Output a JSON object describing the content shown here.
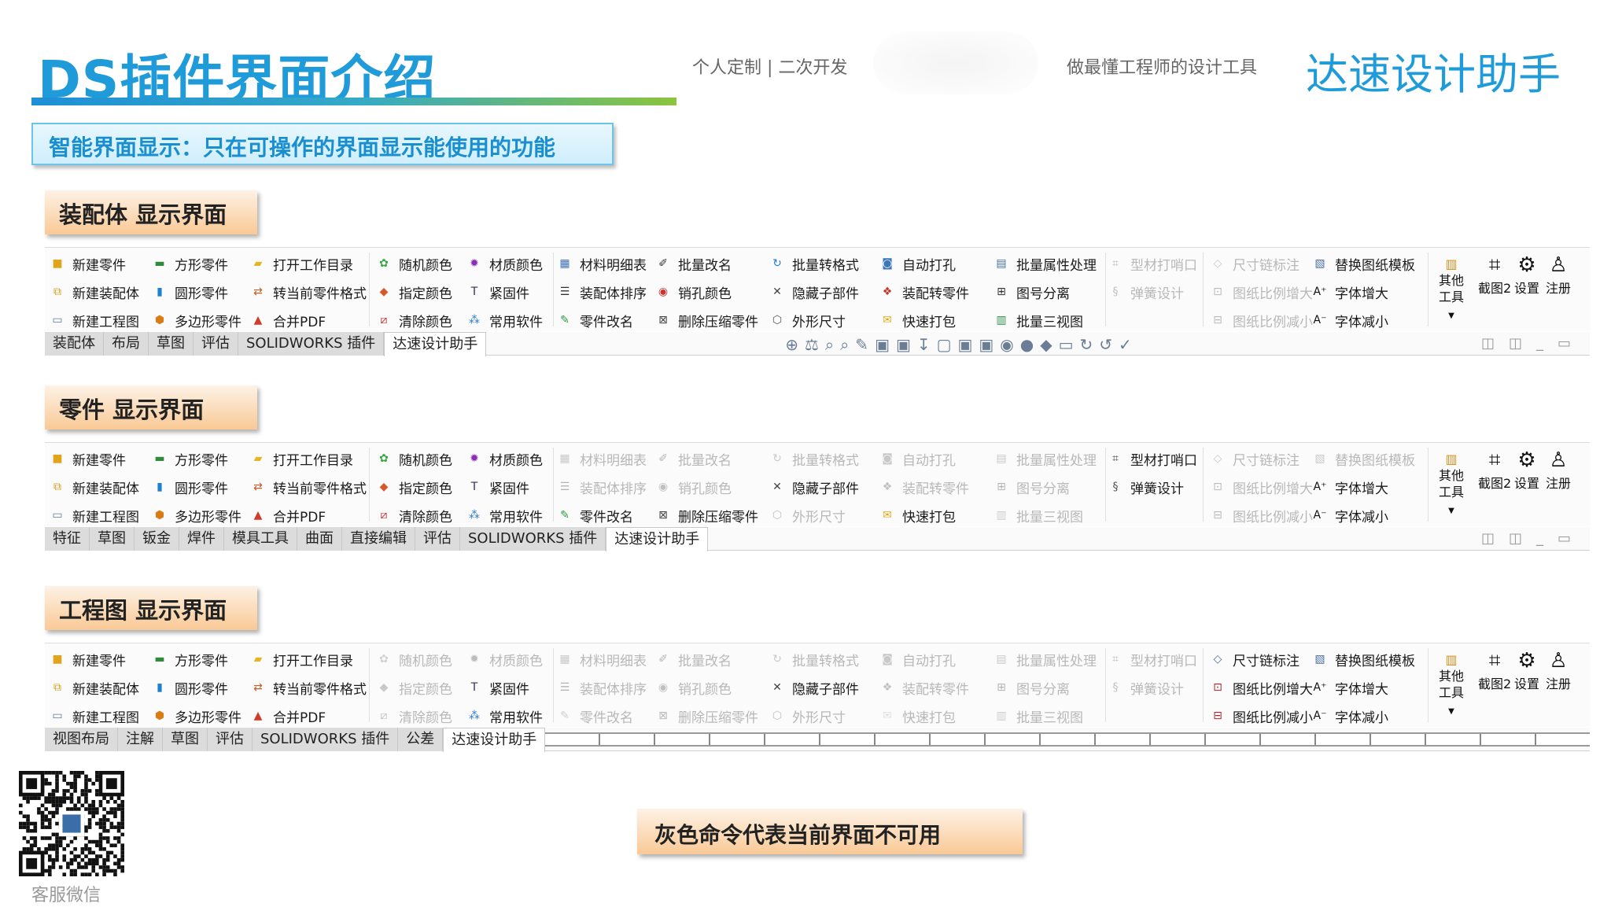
{
  "header": {
    "title": "DS插件界面介绍",
    "tagline_left": "个人定制 | 二次开发",
    "tagline_right": "做最懂工程师的设计工具",
    "brand": "达速设计助手",
    "smart_notice": "智能界面显示：只在可操作的界面显示能使用的功能"
  },
  "colors": {
    "brand_blue": "#1e9bd8",
    "disabled_gray": "#b8b8b8",
    "label_orange": "#f9c995",
    "underline_green": "#8cc43c"
  },
  "sections": [
    {
      "label": "装配体 显示界面",
      "groups": [
        [
          {
            "t": "新建零件",
            "i": "cube-icon",
            "d": false
          },
          {
            "t": "新建装配体",
            "i": "assembly-icon",
            "d": false
          },
          {
            "t": "新建工程图",
            "i": "drawing-icon",
            "d": false
          }
        ],
        [
          {
            "t": "方形零件",
            "i": "box-icon",
            "d": false
          },
          {
            "t": "圆形零件",
            "i": "cylinder-icon",
            "d": false
          },
          {
            "t": "多边形零件",
            "i": "prism-icon",
            "d": false
          }
        ],
        [
          {
            "t": "打开工作目录",
            "i": "folder-icon",
            "d": false
          },
          {
            "t": "转当前零件格式",
            "i": "convert-icon",
            "d": false
          },
          {
            "t": "合并PDF",
            "i": "pdf-icon",
            "d": false
          }
        ],
        [
          {
            "t": "随机颜色",
            "i": "random-color-icon",
            "d": false
          },
          {
            "t": "指定颜色",
            "i": "color-icon",
            "d": false
          },
          {
            "t": "清除颜色",
            "i": "clear-color-icon",
            "d": false
          }
        ],
        [
          {
            "t": "材质颜色",
            "i": "material-icon",
            "d": false
          },
          {
            "t": "紧固件",
            "i": "fastener-icon",
            "d": false
          },
          {
            "t": "常用软件",
            "i": "apps-icon",
            "d": false
          }
        ],
        [
          {
            "t": "材料明细表",
            "i": "bom-icon",
            "d": false
          },
          {
            "t": "装配体排序",
            "i": "sort-icon",
            "d": false
          },
          {
            "t": "零件改名",
            "i": "rename-icon",
            "d": false
          }
        ],
        [
          {
            "t": "批量改名",
            "i": "batch-rename-icon",
            "d": false
          },
          {
            "t": "销孔颜色",
            "i": "pin-hole-icon",
            "d": false
          },
          {
            "t": "删除压缩零件",
            "i": "delete-icon",
            "d": false
          }
        ],
        [
          {
            "t": "批量转格式",
            "i": "batch-convert-icon",
            "d": false
          },
          {
            "t": "隐藏子部件",
            "i": "hide-icon",
            "d": false
          },
          {
            "t": "外形尺寸",
            "i": "dimension-icon",
            "d": false
          }
        ],
        [
          {
            "t": "自动打孔",
            "i": "hole-icon",
            "d": false
          },
          {
            "t": "装配转零件",
            "i": "asm-to-part-icon",
            "d": false
          },
          {
            "t": "快速打包",
            "i": "pack-icon",
            "d": false
          }
        ],
        [
          {
            "t": "批量属性处理",
            "i": "property-icon",
            "d": false
          },
          {
            "t": "图号分离",
            "i": "split-icon",
            "d": false
          },
          {
            "t": "批量三视图",
            "i": "three-view-icon",
            "d": false
          }
        ],
        [
          {
            "t": "型材打哨口",
            "i": "profile-icon",
            "d": true
          },
          {
            "t": "弹簧设计",
            "i": "spring-icon",
            "d": true
          }
        ],
        [
          {
            "t": "尺寸链标注",
            "i": "chain-dim-icon",
            "d": true
          },
          {
            "t": "图纸比例增大",
            "i": "scale-up-icon",
            "d": true
          },
          {
            "t": "图纸比例减小",
            "i": "scale-down-icon",
            "d": true
          }
        ],
        [
          {
            "t": "替换图纸模板",
            "i": "template-icon",
            "d": false
          },
          {
            "t": "字体增大",
            "i": "font-up-icon",
            "d": false
          },
          {
            "t": "字体减小",
            "i": "font-down-icon",
            "d": false
          }
        ]
      ],
      "tabs": [
        "装配体",
        "布局",
        "草图",
        "评估",
        "SOLIDWORKS 插件",
        "达速设计助手"
      ],
      "active_tab": 5
    },
    {
      "label": "零件 显示界面",
      "groups": [
        [
          {
            "t": "新建零件",
            "i": "cube-icon",
            "d": false
          },
          {
            "t": "新建装配体",
            "i": "assembly-icon",
            "d": false
          },
          {
            "t": "新建工程图",
            "i": "drawing-icon",
            "d": false
          }
        ],
        [
          {
            "t": "方形零件",
            "i": "box-icon",
            "d": false
          },
          {
            "t": "圆形零件",
            "i": "cylinder-icon",
            "d": false
          },
          {
            "t": "多边形零件",
            "i": "prism-icon",
            "d": false
          }
        ],
        [
          {
            "t": "打开工作目录",
            "i": "folder-icon",
            "d": false
          },
          {
            "t": "转当前零件格式",
            "i": "convert-icon",
            "d": false
          },
          {
            "t": "合并PDF",
            "i": "pdf-icon",
            "d": false
          }
        ],
        [
          {
            "t": "随机颜色",
            "i": "random-color-icon",
            "d": false
          },
          {
            "t": "指定颜色",
            "i": "color-icon",
            "d": false
          },
          {
            "t": "清除颜色",
            "i": "clear-color-icon",
            "d": false
          }
        ],
        [
          {
            "t": "材质颜色",
            "i": "material-icon",
            "d": false
          },
          {
            "t": "紧固件",
            "i": "fastener-icon",
            "d": false
          },
          {
            "t": "常用软件",
            "i": "apps-icon",
            "d": false
          }
        ],
        [
          {
            "t": "材料明细表",
            "i": "bom-icon",
            "d": true
          },
          {
            "t": "装配体排序",
            "i": "sort-icon",
            "d": true
          },
          {
            "t": "零件改名",
            "i": "rename-icon",
            "d": false
          }
        ],
        [
          {
            "t": "批量改名",
            "i": "batch-rename-icon",
            "d": true
          },
          {
            "t": "销孔颜色",
            "i": "pin-hole-icon",
            "d": true
          },
          {
            "t": "删除压缩零件",
            "i": "delete-icon",
            "d": false
          }
        ],
        [
          {
            "t": "批量转格式",
            "i": "batch-convert-icon",
            "d": true
          },
          {
            "t": "隐藏子部件",
            "i": "hide-icon",
            "d": false
          },
          {
            "t": "外形尺寸",
            "i": "dimension-icon",
            "d": true
          }
        ],
        [
          {
            "t": "自动打孔",
            "i": "hole-icon",
            "d": true
          },
          {
            "t": "装配转零件",
            "i": "asm-to-part-icon",
            "d": true
          },
          {
            "t": "快速打包",
            "i": "pack-icon",
            "d": false
          }
        ],
        [
          {
            "t": "批量属性处理",
            "i": "property-icon",
            "d": true
          },
          {
            "t": "图号分离",
            "i": "split-icon",
            "d": true
          },
          {
            "t": "批量三视图",
            "i": "three-view-icon",
            "d": true
          }
        ],
        [
          {
            "t": "型材打哨口",
            "i": "profile-icon",
            "d": false
          },
          {
            "t": "弹簧设计",
            "i": "spring-icon",
            "d": false
          }
        ],
        [
          {
            "t": "尺寸链标注",
            "i": "chain-dim-icon",
            "d": true
          },
          {
            "t": "图纸比例增大",
            "i": "scale-up-icon",
            "d": true
          },
          {
            "t": "图纸比例减小",
            "i": "scale-down-icon",
            "d": true
          }
        ],
        [
          {
            "t": "替换图纸模板",
            "i": "template-icon",
            "d": true
          },
          {
            "t": "字体增大",
            "i": "font-up-icon",
            "d": false
          },
          {
            "t": "字体减小",
            "i": "font-down-icon",
            "d": false
          }
        ]
      ],
      "tabs": [
        "特征",
        "草图",
        "钣金",
        "焊件",
        "模具工具",
        "曲面",
        "直接编辑",
        "评估",
        "SOLIDWORKS 插件",
        "达速设计助手"
      ],
      "active_tab": 9
    },
    {
      "label": "工程图 显示界面",
      "groups": [
        [
          {
            "t": "新建零件",
            "i": "cube-icon",
            "d": false
          },
          {
            "t": "新建装配体",
            "i": "assembly-icon",
            "d": false
          },
          {
            "t": "新建工程图",
            "i": "drawing-icon",
            "d": false
          }
        ],
        [
          {
            "t": "方形零件",
            "i": "box-icon",
            "d": false
          },
          {
            "t": "圆形零件",
            "i": "cylinder-icon",
            "d": false
          },
          {
            "t": "多边形零件",
            "i": "prism-icon",
            "d": false
          }
        ],
        [
          {
            "t": "打开工作目录",
            "i": "folder-icon",
            "d": false
          },
          {
            "t": "转当前零件格式",
            "i": "convert-icon",
            "d": false
          },
          {
            "t": "合并PDF",
            "i": "pdf-icon",
            "d": false
          }
        ],
        [
          {
            "t": "随机颜色",
            "i": "random-color-icon",
            "d": true
          },
          {
            "t": "指定颜色",
            "i": "color-icon",
            "d": true
          },
          {
            "t": "清除颜色",
            "i": "clear-color-icon",
            "d": true
          }
        ],
        [
          {
            "t": "材质颜色",
            "i": "material-icon",
            "d": true
          },
          {
            "t": "紧固件",
            "i": "fastener-icon",
            "d": false
          },
          {
            "t": "常用软件",
            "i": "apps-icon",
            "d": false
          }
        ],
        [
          {
            "t": "材料明细表",
            "i": "bom-icon",
            "d": true
          },
          {
            "t": "装配体排序",
            "i": "sort-icon",
            "d": true
          },
          {
            "t": "零件改名",
            "i": "rename-icon",
            "d": true
          }
        ],
        [
          {
            "t": "批量改名",
            "i": "batch-rename-icon",
            "d": true
          },
          {
            "t": "销孔颜色",
            "i": "pin-hole-icon",
            "d": true
          },
          {
            "t": "删除压缩零件",
            "i": "delete-icon",
            "d": true
          }
        ],
        [
          {
            "t": "批量转格式",
            "i": "batch-convert-icon",
            "d": true
          },
          {
            "t": "隐藏子部件",
            "i": "hide-icon",
            "d": false
          },
          {
            "t": "外形尺寸",
            "i": "dimension-icon",
            "d": true
          }
        ],
        [
          {
            "t": "自动打孔",
            "i": "hole-icon",
            "d": true
          },
          {
            "t": "装配转零件",
            "i": "asm-to-part-icon",
            "d": true
          },
          {
            "t": "快速打包",
            "i": "pack-icon",
            "d": true
          }
        ],
        [
          {
            "t": "批量属性处理",
            "i": "property-icon",
            "d": true
          },
          {
            "t": "图号分离",
            "i": "split-icon",
            "d": true
          },
          {
            "t": "批量三视图",
            "i": "three-view-icon",
            "d": true
          }
        ],
        [
          {
            "t": "型材打哨口",
            "i": "profile-icon",
            "d": true
          },
          {
            "t": "弹簧设计",
            "i": "spring-icon",
            "d": true
          }
        ],
        [
          {
            "t": "尺寸链标注",
            "i": "chain-dim-icon",
            "d": false
          },
          {
            "t": "图纸比例增大",
            "i": "scale-up-icon",
            "d": false
          },
          {
            "t": "图纸比例减小",
            "i": "scale-down-icon",
            "d": false
          }
        ],
        [
          {
            "t": "替换图纸模板",
            "i": "template-icon",
            "d": false
          },
          {
            "t": "字体增大",
            "i": "font-up-icon",
            "d": false
          },
          {
            "t": "字体减小",
            "i": "font-down-icon",
            "d": false
          }
        ]
      ],
      "tabs": [
        "视图布局",
        "注解",
        "草图",
        "评估",
        "SOLIDWORKS 插件",
        "公差",
        "达速设计助手"
      ],
      "active_tab": 6
    }
  ],
  "ribbon_right": {
    "other_tools": "其他工具",
    "screenshot": "截图2",
    "settings": "设置",
    "register": "注册"
  },
  "footer": {
    "qr_label": "客服微信",
    "note": "灰色命令代表当前界面不可用"
  }
}
